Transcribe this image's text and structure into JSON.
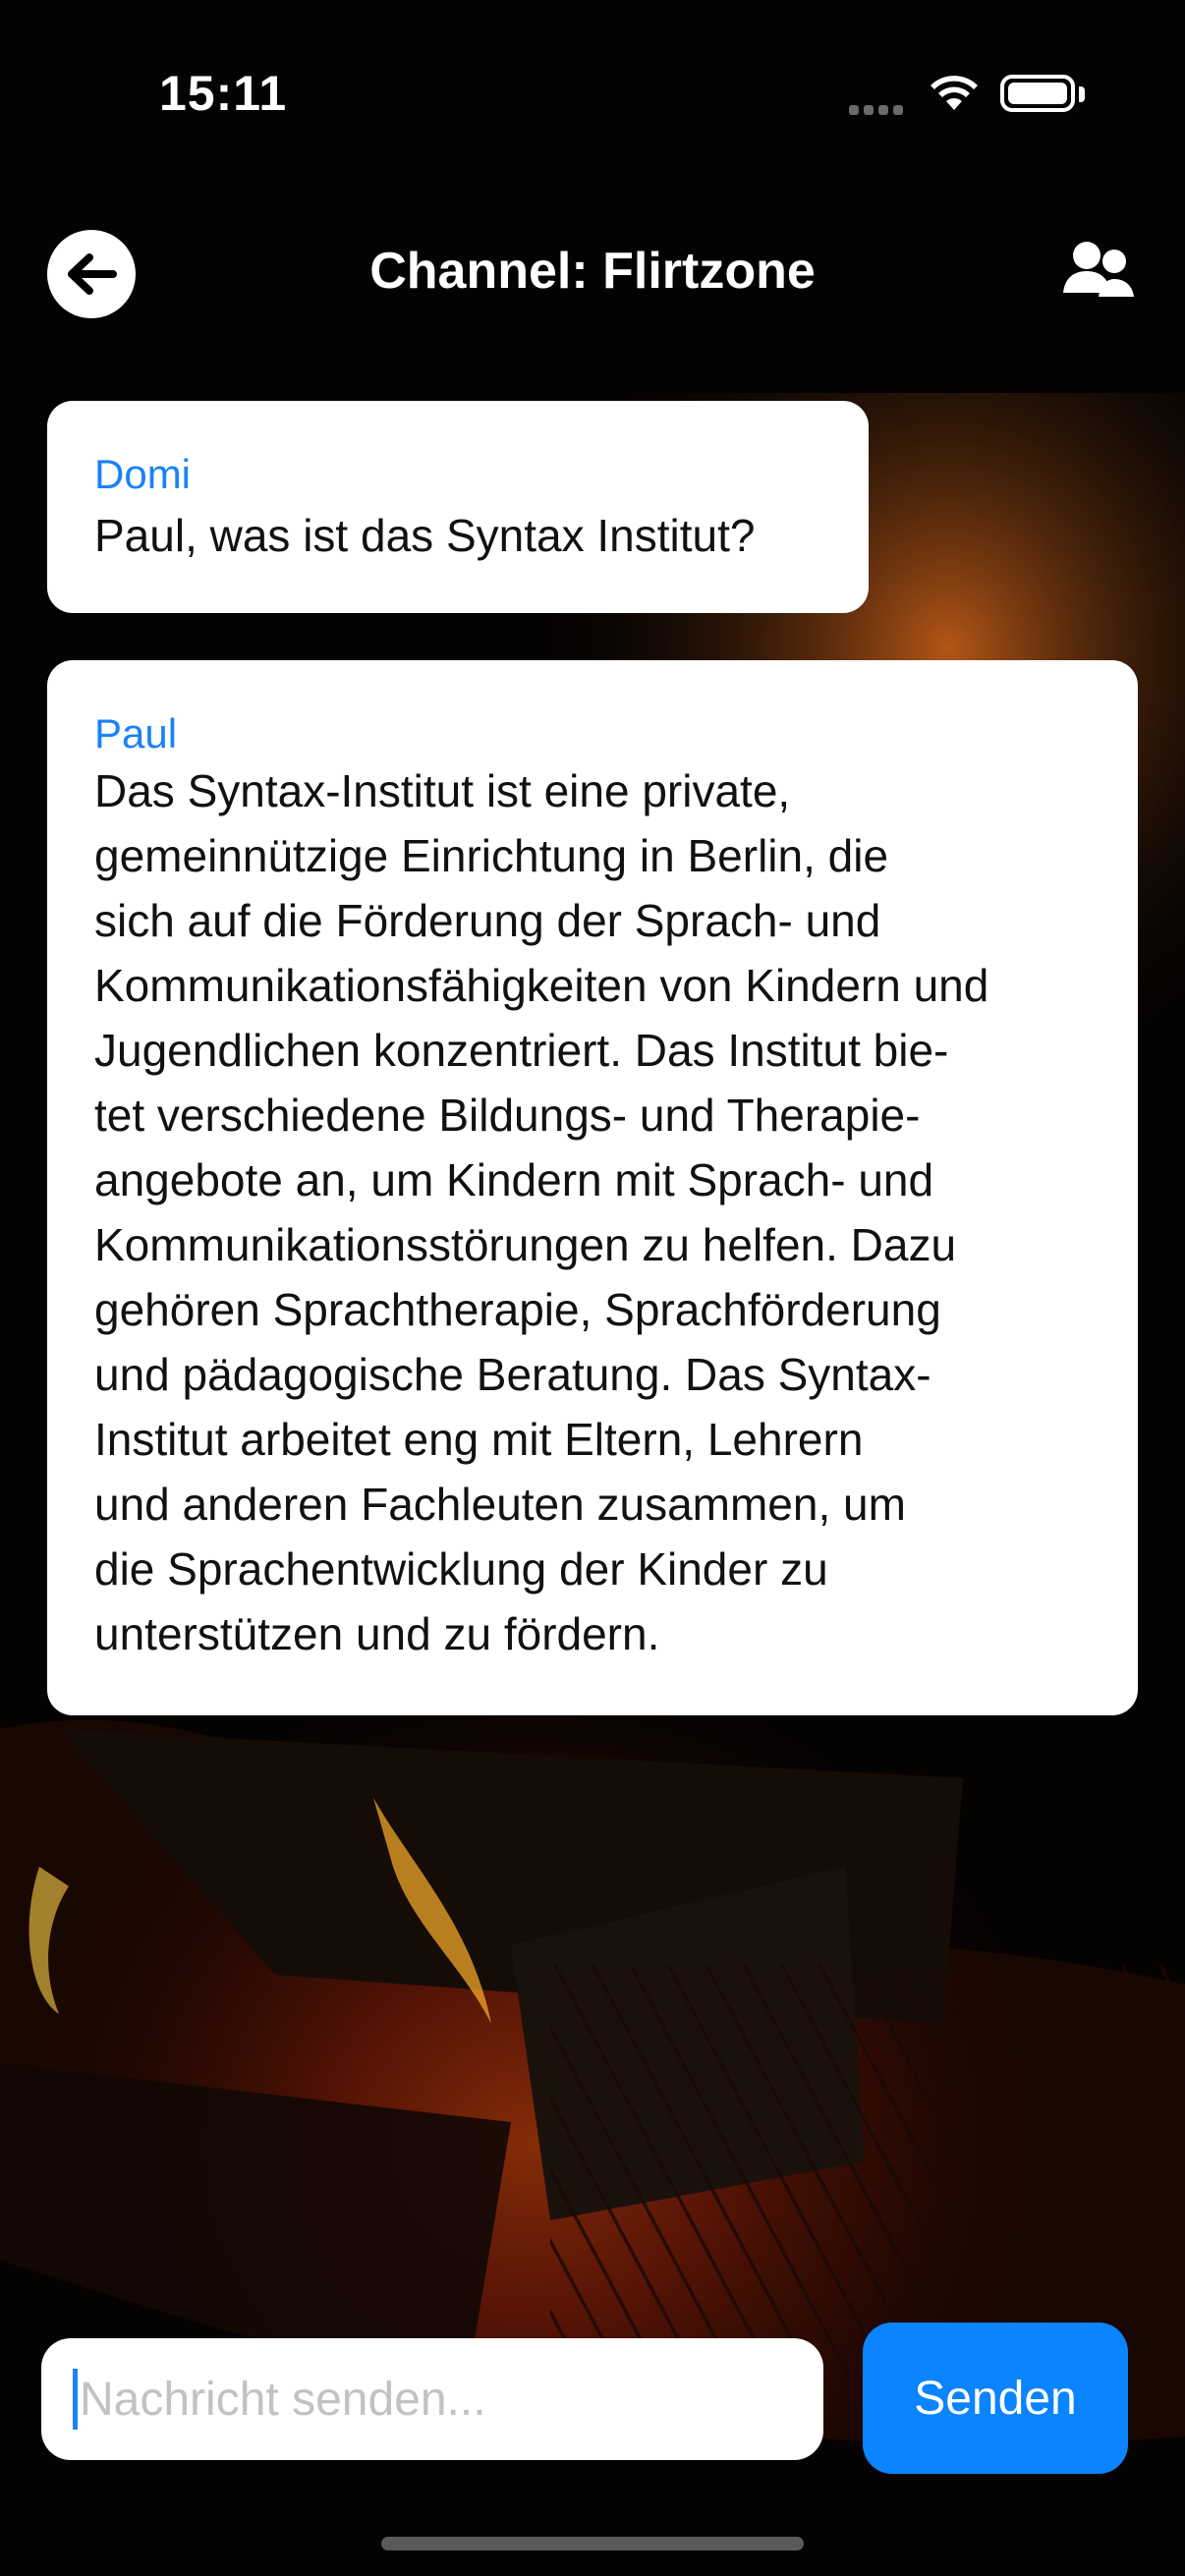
{
  "status_bar": {
    "time": "15:11"
  },
  "header": {
    "title": "Channel: Flirtzone"
  },
  "messages": [
    {
      "sender": "Domi",
      "lines": [
        "Paul, was ist das Syntax Institut?"
      ]
    },
    {
      "sender": "Paul",
      "lines": [
        "Das Syntax-Institut ist eine private,",
        "gemeinnützige Einrichtung in Berlin, die",
        "sich auf die Förderung der Sprach- und",
        "Kommunikationsfähigkeiten von Kindern und",
        "Jugendlichen konzentriert. Das Institut bie-",
        "tet verschiedene Bildungs- und Therapie-",
        "angebote an, um Kindern mit Sprach- und",
        "Kommunikationsstörungen zu helfen. Dazu",
        "gehören Sprachtherapie, Sprachförderung",
        "und pädagogische Beratung. Das Syntax-",
        "Institut arbeitet eng mit Eltern, Lehrern",
        "und anderen Fachleuten zusammen, um",
        "die Sprachentwicklung der Kinder zu",
        "unterstützen und zu fördern."
      ]
    }
  ],
  "composer": {
    "placeholder": "Nachricht senden...",
    "send_label": "Senden"
  },
  "icons": {
    "back": "arrow-left-icon",
    "members": "people-icon"
  },
  "colors": {
    "accent": "#0a84ff",
    "sender": "#1a82f7"
  }
}
